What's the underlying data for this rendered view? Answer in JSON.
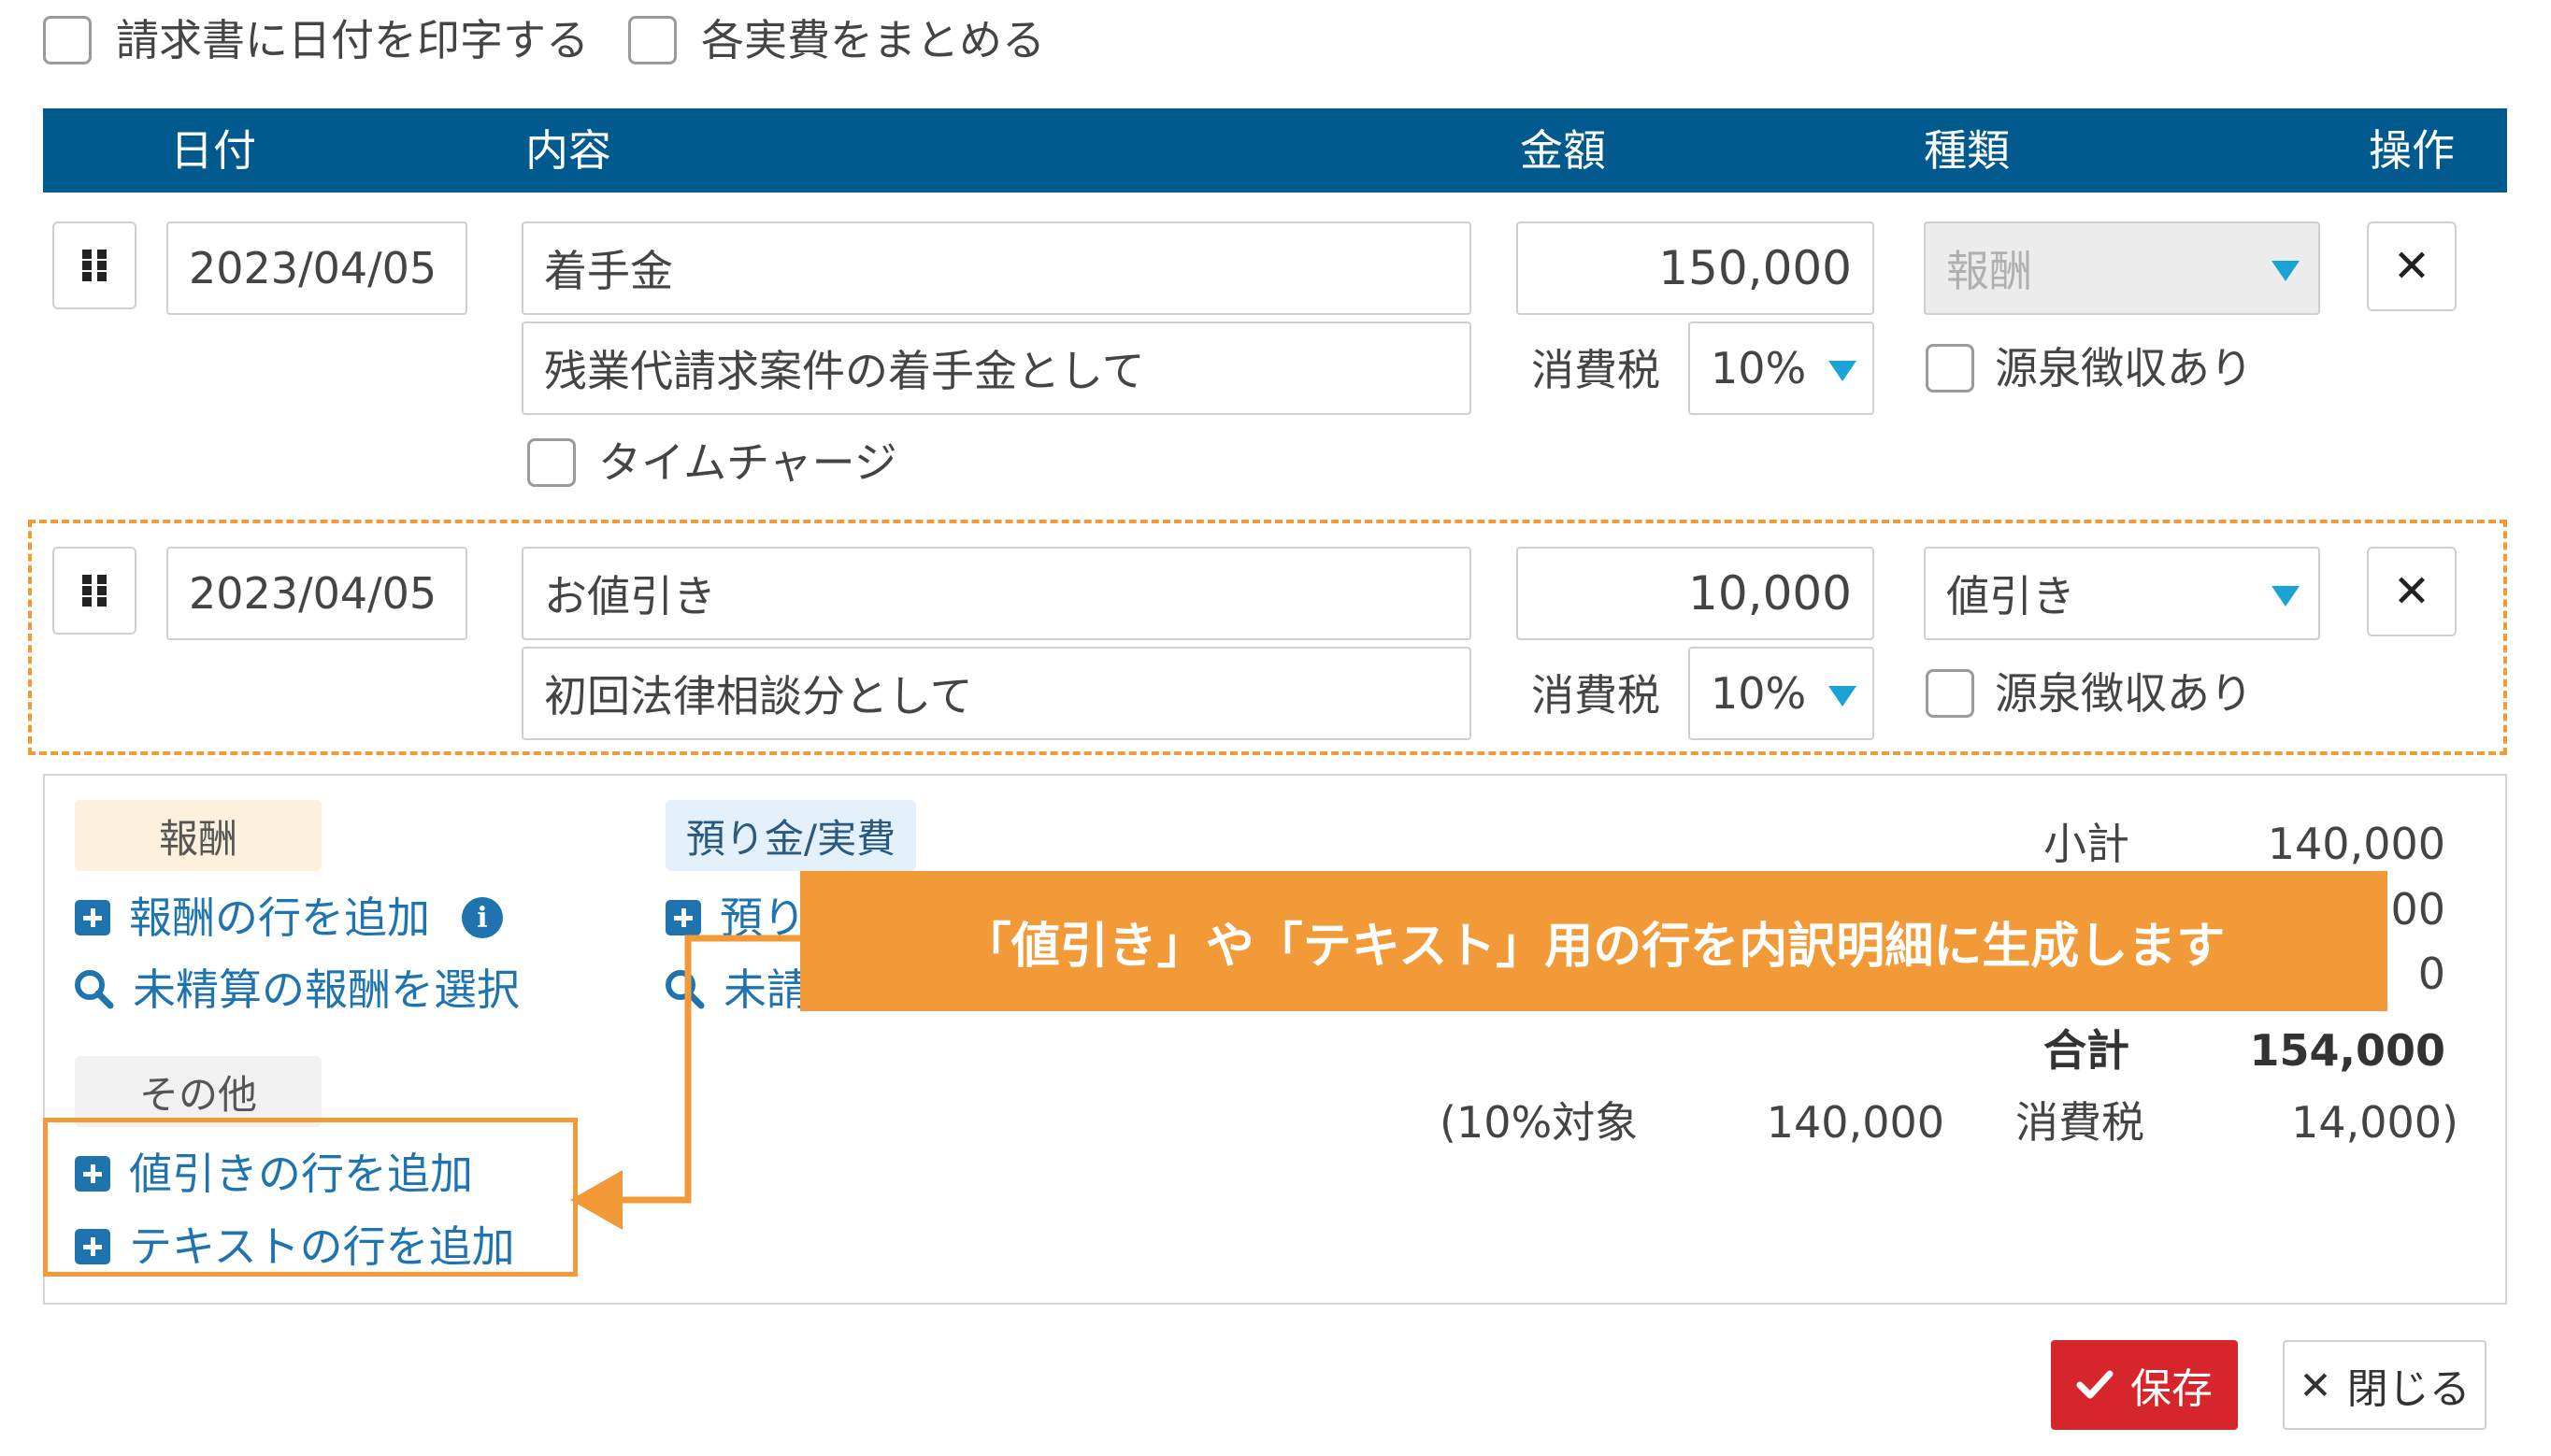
{
  "top_options": {
    "print_date_label": "請求書に日付を印字する",
    "merge_expenses_label": "各実費をまとめる"
  },
  "table_header": {
    "date": "日付",
    "content": "内容",
    "amount": "金額",
    "type": "種類",
    "action": "操作"
  },
  "rows": [
    {
      "date": "2023/04/05",
      "title": "着手金",
      "description": "残業代請求案件の着手金として",
      "amount": "150,000",
      "type": "報酬",
      "tax_label": "消費税",
      "tax_rate": "10%",
      "withholding_label": "源泉徴収あり",
      "time_charge_label": "タイムチャージ"
    },
    {
      "date": "2023/04/05",
      "title": "お値引き",
      "description": "初回法律相談分として",
      "amount": "10,000",
      "type": "値引き",
      "tax_label": "消費税",
      "tax_rate": "10%",
      "withholding_label": "源泉徴収あり"
    }
  ],
  "panel": {
    "fee_tag": "報酬",
    "add_fee_row": "報酬の行を追加",
    "select_unsettled_fee": "未精算の報酬を選択",
    "deposit_tag": "預り金/実費",
    "add_deposit_row_partial": "預り",
    "select_unsettled_deposit_partial": "未請",
    "other_tag": "その他",
    "add_discount_row": "値引きの行を追加",
    "add_text_row": "テキストの行を追加"
  },
  "totals": {
    "subtotal_label": "小計",
    "subtotal_value": "140,000",
    "row2_value_partial": "00",
    "row3_value": "0",
    "total_label": "合計",
    "total_value": "154,000",
    "tax_target": "(10%対象",
    "tax_target_value": "140,000",
    "tax_label": "消費税",
    "tax_value": "14,000)"
  },
  "callout": {
    "text": "「値引き」や「テキスト」用の行を内訳明細に生成します"
  },
  "footer": {
    "save_label": "保存",
    "close_label": "閉じる"
  },
  "colors": {
    "header_bg": "#005a8e",
    "accent_orange": "#f39a38",
    "link_blue": "#1f74b0",
    "select_arrow": "#1aa3d4",
    "save_red": "#d7262b"
  }
}
